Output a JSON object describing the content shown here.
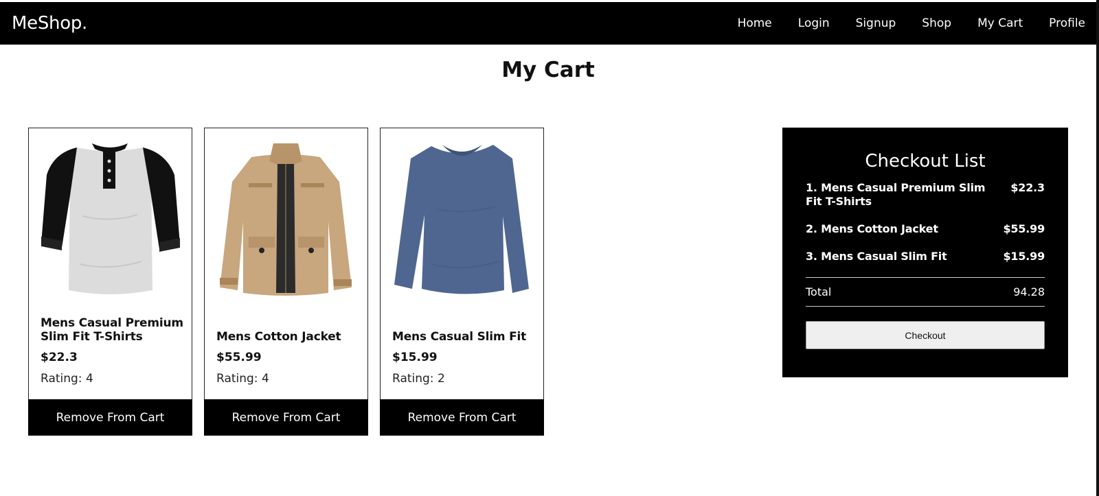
{
  "nav": {
    "brand": "MeShop.",
    "links": [
      "Home",
      "Login",
      "Signup",
      "Shop",
      "My Cart",
      "Profile"
    ]
  },
  "page": {
    "title": "My Cart"
  },
  "cart_items": [
    {
      "name": "Mens Casual Premium Slim Fit T-Shirts",
      "price": "$22.3",
      "rating": "Rating: 4",
      "remove_label": "Remove From Cart",
      "image_icon": "tshirt-image"
    },
    {
      "name": "Mens Cotton Jacket",
      "price": "$55.99",
      "rating": "Rating: 4",
      "remove_label": "Remove From Cart",
      "image_icon": "jacket-image"
    },
    {
      "name": "Mens Casual Slim Fit",
      "price": "$15.99",
      "rating": "Rating: 2",
      "remove_label": "Remove From Cart",
      "image_icon": "longsleeve-image"
    }
  ],
  "checkout": {
    "title": "Checkout List",
    "items": [
      {
        "name": "1. Mens Casual Premium Slim Fit T-Shirts",
        "price": "$22.3"
      },
      {
        "name": "2. Mens Cotton Jacket",
        "price": "$55.99"
      },
      {
        "name": "3. Mens Casual Slim Fit",
        "price": "$15.99"
      }
    ],
    "total_label": "Total",
    "total_value": "94.28",
    "button_label": "Checkout"
  },
  "colors": {
    "navbar": "#000000",
    "panel": "#000000",
    "button": "#efefef"
  }
}
